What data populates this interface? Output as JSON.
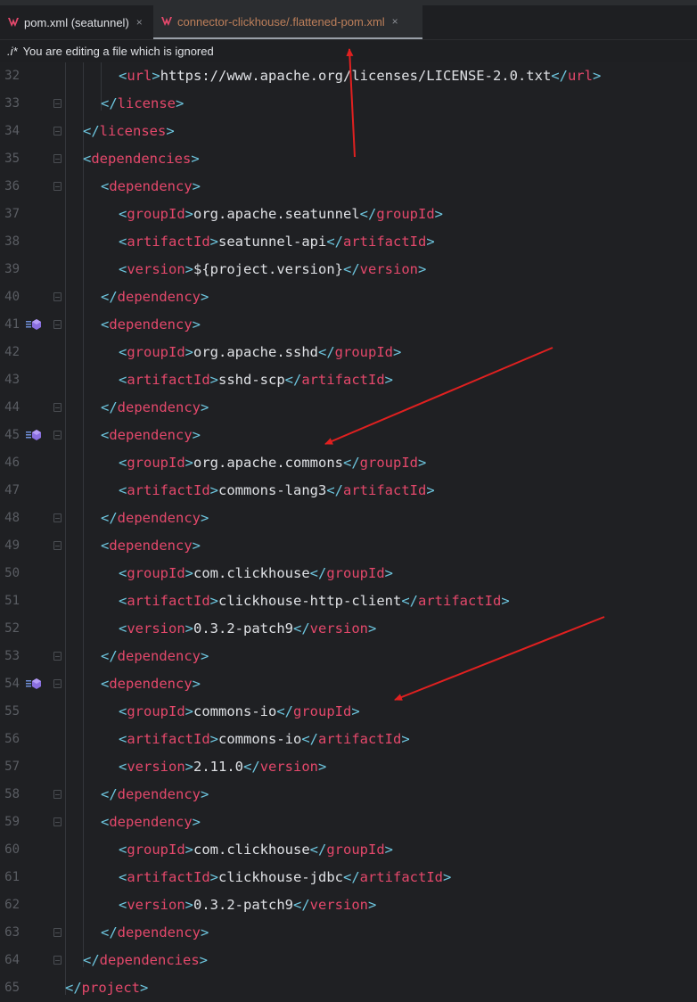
{
  "tabs": [
    {
      "label": "pom.xml (seatunnel)",
      "close": "×",
      "active": false
    },
    {
      "label": "connector-clickhouse/.flattened-pom.xml",
      "close": "×",
      "active": true
    }
  ],
  "notice": {
    "icon": ".i*",
    "text": "You are editing a file which is ignored"
  },
  "colors": {
    "punct": "#6ec7e0",
    "tag": "#e4486b",
    "text": "#dfe1e5",
    "line_number": "#5a5d63",
    "arrow": "#e02020"
  },
  "lines": [
    {
      "n": "32",
      "indent": 3,
      "tag": "url",
      "value": "https://www.apache.org/licenses/LICENSE-2.0.txt",
      "type": "full"
    },
    {
      "n": "33",
      "indent": 2,
      "tag": "license",
      "type": "close",
      "fold": true
    },
    {
      "n": "34",
      "indent": 1,
      "tag": "licenses",
      "type": "close",
      "fold": true
    },
    {
      "n": "35",
      "indent": 1,
      "tag": "dependencies",
      "type": "open",
      "fold": true
    },
    {
      "n": "36",
      "indent": 2,
      "tag": "dependency",
      "type": "open",
      "fold": true
    },
    {
      "n": "37",
      "indent": 3,
      "tag": "groupId",
      "value": "org.apache.seatunnel",
      "type": "full"
    },
    {
      "n": "38",
      "indent": 3,
      "tag": "artifactId",
      "value": "seatunnel-api",
      "type": "full"
    },
    {
      "n": "39",
      "indent": 3,
      "tag": "version",
      "value": "${project.version}",
      "type": "full"
    },
    {
      "n": "40",
      "indent": 2,
      "tag": "dependency",
      "type": "close",
      "fold": true
    },
    {
      "n": "41",
      "indent": 2,
      "tag": "dependency",
      "type": "open",
      "fold": true,
      "maven": true
    },
    {
      "n": "42",
      "indent": 3,
      "tag": "groupId",
      "value": "org.apache.sshd",
      "type": "full"
    },
    {
      "n": "43",
      "indent": 3,
      "tag": "artifactId",
      "value": "sshd-scp",
      "type": "full"
    },
    {
      "n": "44",
      "indent": 2,
      "tag": "dependency",
      "type": "close",
      "fold": true
    },
    {
      "n": "45",
      "indent": 2,
      "tag": "dependency",
      "type": "open",
      "fold": true,
      "maven": true
    },
    {
      "n": "46",
      "indent": 3,
      "tag": "groupId",
      "value": "org.apache.commons",
      "type": "full"
    },
    {
      "n": "47",
      "indent": 3,
      "tag": "artifactId",
      "value": "commons-lang3",
      "type": "full"
    },
    {
      "n": "48",
      "indent": 2,
      "tag": "dependency",
      "type": "close",
      "fold": true
    },
    {
      "n": "49",
      "indent": 2,
      "tag": "dependency",
      "type": "open",
      "fold": true
    },
    {
      "n": "50",
      "indent": 3,
      "tag": "groupId",
      "value": "com.clickhouse",
      "type": "full"
    },
    {
      "n": "51",
      "indent": 3,
      "tag": "artifactId",
      "value": "clickhouse-http-client",
      "type": "full"
    },
    {
      "n": "52",
      "indent": 3,
      "tag": "version",
      "value": "0.3.2-patch9",
      "type": "full"
    },
    {
      "n": "53",
      "indent": 2,
      "tag": "dependency",
      "type": "close",
      "fold": true
    },
    {
      "n": "54",
      "indent": 2,
      "tag": "dependency",
      "type": "open",
      "fold": true,
      "maven": true
    },
    {
      "n": "55",
      "indent": 3,
      "tag": "groupId",
      "value": "commons-io",
      "type": "full"
    },
    {
      "n": "56",
      "indent": 3,
      "tag": "artifactId",
      "value": "commons-io",
      "type": "full"
    },
    {
      "n": "57",
      "indent": 3,
      "tag": "version",
      "value": "2.11.0",
      "type": "full"
    },
    {
      "n": "58",
      "indent": 2,
      "tag": "dependency",
      "type": "close",
      "fold": true
    },
    {
      "n": "59",
      "indent": 2,
      "tag": "dependency",
      "type": "open",
      "fold": true
    },
    {
      "n": "60",
      "indent": 3,
      "tag": "groupId",
      "value": "com.clickhouse",
      "type": "full"
    },
    {
      "n": "61",
      "indent": 3,
      "tag": "artifactId",
      "value": "clickhouse-jdbc",
      "type": "full"
    },
    {
      "n": "62",
      "indent": 3,
      "tag": "version",
      "value": "0.3.2-patch9",
      "type": "full"
    },
    {
      "n": "63",
      "indent": 2,
      "tag": "dependency",
      "type": "close",
      "fold": true
    },
    {
      "n": "64",
      "indent": 1,
      "tag": "dependencies",
      "type": "close",
      "fold": true
    },
    {
      "n": "65",
      "indent": 0,
      "tag": "project",
      "type": "close",
      "fold": false
    }
  ]
}
